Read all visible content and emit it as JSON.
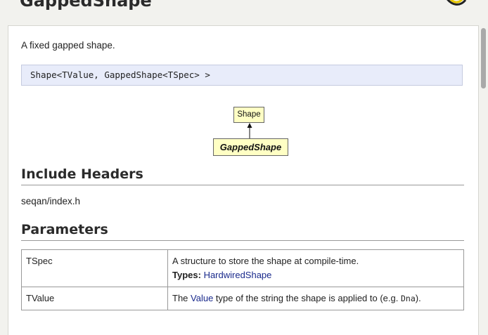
{
  "page": {
    "title": "GappedShape"
  },
  "content": {
    "description": "A fixed gapped shape.",
    "signature": "Shape<TValue, GappedShape<TSpec> >",
    "diagram": {
      "parent": "Shape",
      "self": "GappedShape"
    },
    "include_heading": "Include Headers",
    "include_path": "seqan/index.h",
    "params_heading": "Parameters",
    "params": [
      {
        "name": "TSpec",
        "desc": "A structure to store the shape at compile-time.",
        "types_label": "Types:",
        "types_link": "HardwiredShape"
      },
      {
        "name": "TValue",
        "desc_pre": "The ",
        "desc_link": "Value",
        "desc_mid": " type of the string the shape is applied to (e.g. ",
        "desc_code": "Dna",
        "desc_post": ")."
      }
    ]
  },
  "colors": {
    "background": "#f2f2ee",
    "signature_bg": "#e8ecfa",
    "node_bg": "#ffffc4",
    "link": "#1a2a8c"
  },
  "icons": [
    "logo-icon"
  ]
}
